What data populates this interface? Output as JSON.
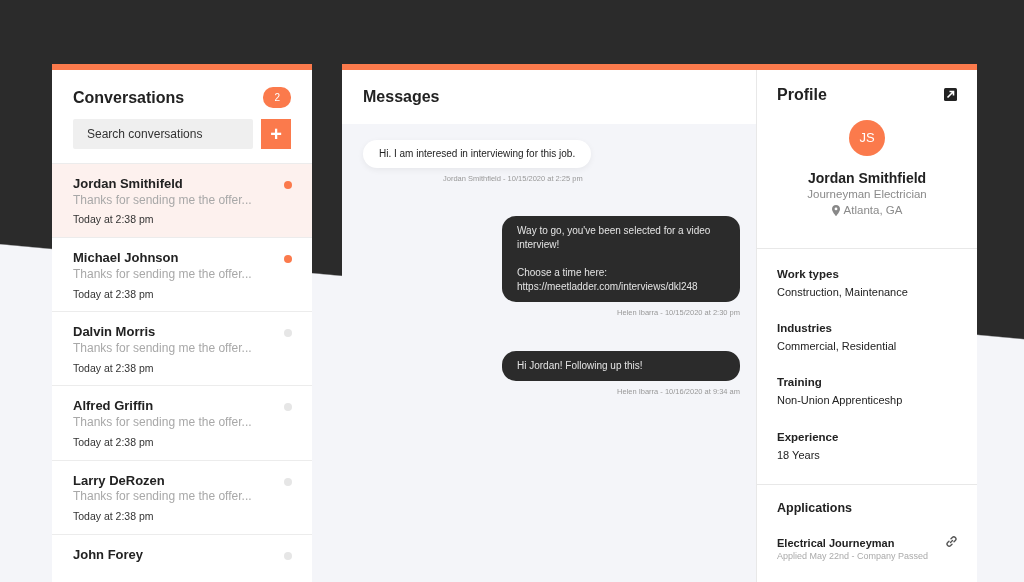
{
  "conversations": {
    "title": "Conversations",
    "unread_count": "2",
    "search": {
      "placeholder": "Search conversations"
    },
    "add_button": "+",
    "items": [
      {
        "name": "Jordan Smithifeld",
        "preview": "Thanks for sending me the offer...",
        "time": "Today at 2:38 pm",
        "selected": true,
        "unread": true
      },
      {
        "name": "Michael Johnson",
        "preview": "Thanks for sending me the offer...",
        "time": "Today at 2:38 pm",
        "selected": false,
        "unread": true
      },
      {
        "name": "Dalvin Morris",
        "preview": "Thanks for sending me the offer...",
        "time": "Today at 2:38 pm",
        "selected": false,
        "unread": false
      },
      {
        "name": "Alfred Griffin",
        "preview": "Thanks for sending me the offer...",
        "time": "Today at 2:38 pm",
        "selected": false,
        "unread": false
      },
      {
        "name": "Larry DeRozen",
        "preview": "Thanks for sending me the offer...",
        "time": "Today at 2:38 pm",
        "selected": false,
        "unread": false
      },
      {
        "name": "John Forey",
        "selected": false,
        "unread": false
      }
    ]
  },
  "messages": {
    "title": "Messages",
    "items": [
      {
        "kind": "incoming",
        "text": "Hi. I am interesed in interviewing for this job.",
        "meta": "Jordan Smithfield - 10/15/2020 at 2:25 pm"
      },
      {
        "kind": "outgoing",
        "text": "Way to go, you've been selected for a video interview!\n\nChoose a time here:\nhttps://meetladder.com/interviews/dkl248",
        "meta": "Helen Ibarra - 10/15/2020 at 2:30 pm"
      },
      {
        "kind": "outgoing",
        "text": "Hi Jordan! Following up this!",
        "meta": "Helen Ibarra - 10/16/2020 at 9:34 am"
      }
    ]
  },
  "profile": {
    "title": "Profile",
    "initials": "JS",
    "name": "Jordan Smithfield",
    "job": "Journeyman Electrician",
    "location": "Atlanta, GA",
    "fields": [
      {
        "label": "Work types",
        "value": "Construction, Maintenance"
      },
      {
        "label": "Industries",
        "value": "Commercial, Residential"
      },
      {
        "label": "Training",
        "value": "Non-Union Apprenticeshp"
      },
      {
        "label": "Experience",
        "value": "18 Years"
      }
    ],
    "applications": {
      "title": "Applications",
      "items": [
        {
          "title": "Electrical Journeyman",
          "meta": "Applied May 22nd - Company Passed"
        }
      ]
    }
  }
}
